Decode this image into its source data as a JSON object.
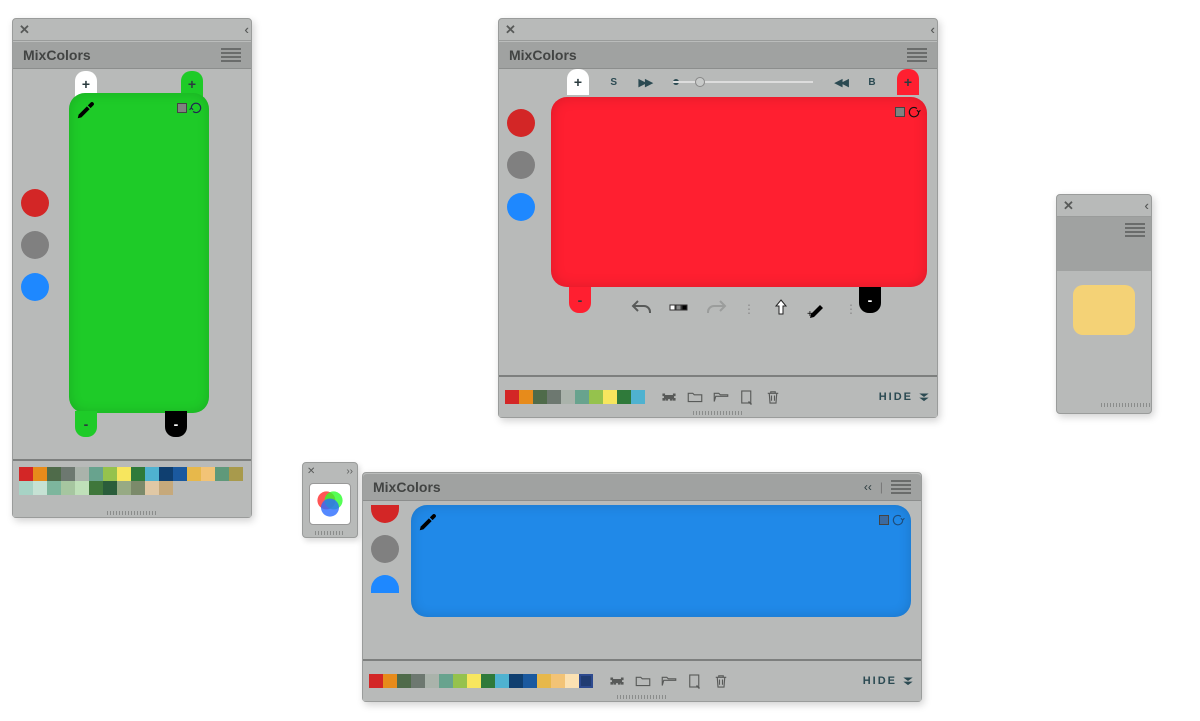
{
  "app_title": "MixColors",
  "hide_label": "HIDE",
  "slider": {
    "s_label": "S",
    "b_label": "B"
  },
  "panelA": {
    "dots": [
      "#d32626",
      "#808080",
      "#1e88ff"
    ],
    "mix_color": "#1ecb28",
    "taps": {
      "tl": {
        "bg": "#ffffff",
        "fg": "#000",
        "sign": "+"
      },
      "tr": {
        "bg": "#1ecb28",
        "fg": "#000",
        "sign": "+"
      },
      "bl": {
        "bg": "#1ecb28",
        "fg": "#000",
        "sign": "-"
      },
      "br": {
        "bg": "#000000",
        "fg": "#fff",
        "sign": "-"
      }
    },
    "swatches": [
      "#d32626",
      "#e78b1b",
      "#4f6b4a",
      "#6d7870",
      "#aab3ab",
      "#68a38e",
      "#95c24d",
      "#f7e65e",
      "#2f7a3a",
      "#4fb2d0",
      "#0f3f70",
      "#1a599f",
      "#e7b84b",
      "#f2c376",
      "#5f997a",
      "#a89a4c",
      "#a7d3c5",
      "#c6e2d4",
      "#7db69d",
      "#a6c6a0",
      "#bfe0b9",
      "#3f773b",
      "#2a5d3b",
      "#97aa84",
      "#7b8a6a",
      "#e0c8a5",
      "#c6a97b"
    ]
  },
  "panelB": {
    "dots": [
      "#d32626",
      "#808080",
      "#1e88ff"
    ],
    "mix_color": "#ff1f30",
    "taps": {
      "tl": {
        "bg": "#ffffff",
        "fg": "#000",
        "sign": "+"
      },
      "tr": {
        "bg": "#ff1f30",
        "fg": "#000",
        "sign": "+"
      },
      "bl": {
        "bg": "#ff1f30",
        "fg": "#000",
        "sign": "-"
      },
      "br": {
        "bg": "#000000",
        "fg": "#fff",
        "sign": "-"
      }
    },
    "swatches": [
      "#d32626",
      "#e78b1b",
      "#4f6b4a",
      "#6d7870",
      "#aab3ab",
      "#68a38e",
      "#95c24d",
      "#f7e65e",
      "#2f7a3a",
      "#4fb2d0"
    ]
  },
  "panelC": {
    "dots": [
      "#d32626",
      "#808080",
      "#1e88ff"
    ],
    "mix_color": "#2089e8",
    "swatches": [
      "#d32626",
      "#e78b1b",
      "#4f6b4a",
      "#6d7870",
      "#aab3ab",
      "#68a38e",
      "#95c24d",
      "#f7e65e",
      "#2f7a3a",
      "#4fb2d0",
      "#0f3f70",
      "#1a599f",
      "#e7b84b",
      "#f2c376",
      "#fbe1b2",
      "#203c72"
    ],
    "selected_swatch": 15
  },
  "panelD": {
    "mix_color": "#f4d276"
  }
}
